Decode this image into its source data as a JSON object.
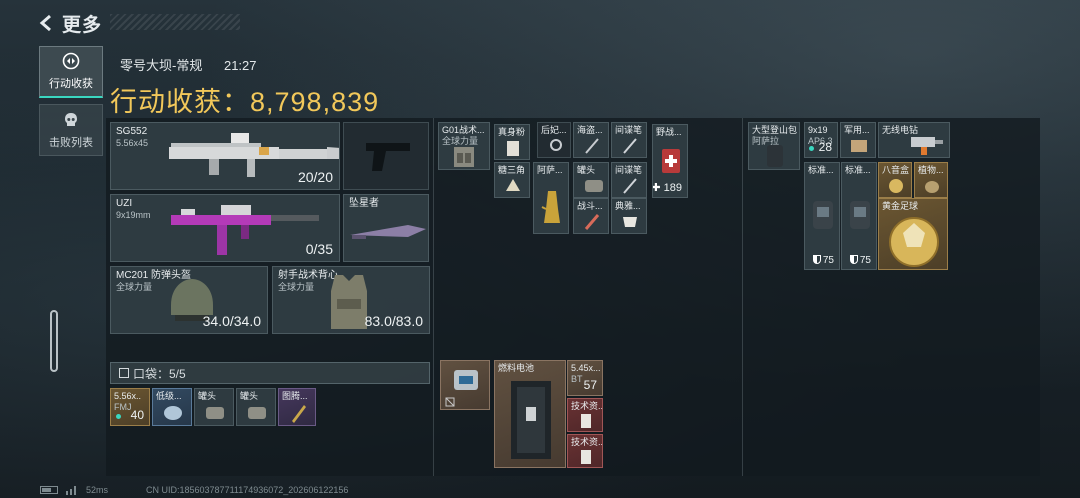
{
  "header": {
    "back_label": "更多"
  },
  "side_nav": {
    "tabs": [
      {
        "label": "行动收获",
        "active": true,
        "icon": "loot-icon"
      },
      {
        "label": "击败列表",
        "active": false,
        "icon": "skull-icon"
      }
    ]
  },
  "summary": {
    "map_mode": "零号大坝-常规",
    "duration": "21:27",
    "harvest_label": "行动收获：",
    "harvest_value": "8,798,839"
  },
  "loadout": {
    "primary": {
      "name": "SG552",
      "ammo": "5.56x45",
      "count": "20/20"
    },
    "sidearm": {
      "name": ""
    },
    "secondary": {
      "name": "UZI",
      "ammo": "9x19mm",
      "count": "0/35"
    },
    "melee": {
      "name": "坠星者"
    },
    "helmet": {
      "name": "MC201 防弹头盔",
      "sub": "全球力量",
      "count": "34.0/34.0"
    },
    "armor": {
      "name": "射手战术背心",
      "sub": "全球力量",
      "count": "83.0/83.0"
    }
  },
  "pocket": {
    "label": "口袋：5/5",
    "items": [
      {
        "name": "5.56x..",
        "sub": "FMJ",
        "count": "40"
      },
      {
        "name": "低级...",
        "sub": "",
        "count": ""
      },
      {
        "name": "罐头",
        "sub": "",
        "count": ""
      },
      {
        "name": "罐头",
        "sub": "",
        "count": ""
      },
      {
        "name": "图腾...",
        "sub": "",
        "count": ""
      }
    ]
  },
  "chest_rig": {
    "rig": {
      "name": "G01战术...",
      "sub": "全球力量"
    },
    "items": [
      {
        "name": "真身粉",
        "sub": ""
      },
      {
        "name": "后妃...",
        "sub": ""
      },
      {
        "name": "海盗...",
        "sub": ""
      },
      {
        "name": "间谍笔",
        "sub": ""
      },
      {
        "name": "野战...",
        "sub": "",
        "count": "189"
      },
      {
        "name": "糖三角",
        "sub": ""
      },
      {
        "name": "阿萨...",
        "sub": ""
      },
      {
        "name": "罐头",
        "sub": ""
      },
      {
        "name": "间谍笔",
        "sub": ""
      },
      {
        "name": "战斗...",
        "sub": ""
      },
      {
        "name": "典雅...",
        "sub": ""
      }
    ]
  },
  "backpack_small": {
    "items": [
      {
        "name": "",
        "sub": ""
      },
      {
        "name": "燃料电池",
        "sub": ""
      },
      {
        "name": "5.45x...",
        "sub": "BT",
        "count": "57"
      },
      {
        "name": "技术资...",
        "sub": ""
      },
      {
        "name": "技术资...",
        "sub": ""
      }
    ]
  },
  "backpack": {
    "bag": {
      "name": "大型登山包",
      "sub": "阿萨拉"
    },
    "items": [
      {
        "name": "9x19",
        "sub": "AP6.3",
        "count": "28"
      },
      {
        "name": "军用...",
        "sub": ""
      },
      {
        "name": "无线电钻",
        "sub": ""
      },
      {
        "name": "标准...",
        "sub": "",
        "count": "75"
      },
      {
        "name": "标准...",
        "sub": "",
        "count": "75"
      },
      {
        "name": "八音盒",
        "sub": ""
      },
      {
        "name": "植物...",
        "sub": ""
      },
      {
        "name": "黄金足球",
        "sub": ""
      }
    ]
  },
  "footer": {
    "ping": "52ms",
    "uid": "CN UID:1856037877111749360​72_202606122156"
  },
  "colors": {
    "accent": "#3ad7c0",
    "gold": "#f2c85a",
    "panel": "#121a1f"
  }
}
